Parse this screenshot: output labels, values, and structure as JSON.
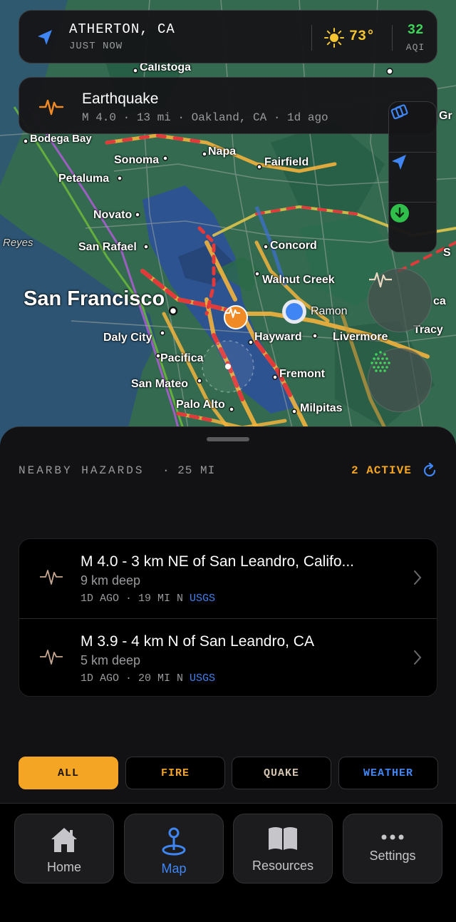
{
  "map": {
    "cities": [
      {
        "name": "Calistoga",
        "cls": ""
      },
      {
        "name": "Bodega Bay",
        "cls": ""
      },
      {
        "name": "Sonoma",
        "cls": ""
      },
      {
        "name": "Napa",
        "cls": ""
      },
      {
        "name": "Fairfield",
        "cls": ""
      },
      {
        "name": "Petaluma",
        "cls": ""
      },
      {
        "name": "Novato",
        "cls": ""
      },
      {
        "name": "Reyes",
        "cls": "italic"
      },
      {
        "name": "San Rafael",
        "cls": ""
      },
      {
        "name": "Concord",
        "cls": ""
      },
      {
        "name": "Walnut Creek",
        "cls": ""
      },
      {
        "name": "San Francisco",
        "cls": "big"
      },
      {
        "name": "Ramon",
        "cls": ""
      },
      {
        "name": "Daly City",
        "cls": ""
      },
      {
        "name": "Hayward",
        "cls": ""
      },
      {
        "name": "Livermore",
        "cls": ""
      },
      {
        "name": "Pacifica",
        "cls": ""
      },
      {
        "name": "Fremont",
        "cls": ""
      },
      {
        "name": "San Mateo",
        "cls": ""
      },
      {
        "name": "Palo Alto",
        "cls": ""
      },
      {
        "name": "Milpitas",
        "cls": ""
      },
      {
        "name": "Tracy",
        "cls": ""
      },
      {
        "name": "Gr",
        "cls": ""
      },
      {
        "name": "ca",
        "cls": ""
      },
      {
        "name": "S",
        "cls": ""
      }
    ]
  },
  "location_bar": {
    "place": "ATHERTON, CA",
    "updated": "JUST NOW",
    "temperature": "73°",
    "aqi_value": "32",
    "aqi_label": "AQI"
  },
  "alert_banner": {
    "title": "Earthquake",
    "subtitle": "M 4.0 · 13 mi · Oakland, CA · 1d ago"
  },
  "sheet": {
    "title": "NEARBY HAZARDS",
    "distance": "· 25 MI",
    "active": "2 ACTIVE",
    "hazards": [
      {
        "title": "M 4.0 - 3 km NE of San Leandro, Califo...",
        "depth": "9 km deep",
        "meta": "1D AGO · 19 MI N",
        "source": "USGS"
      },
      {
        "title": "M 3.9 - 4 km N of San Leandro, CA",
        "depth": "5 km deep",
        "meta": "1D AGO · 20 MI N",
        "source": "USGS"
      }
    ],
    "filters": [
      {
        "label": "ALL",
        "color": "#1a1300"
      },
      {
        "label": "FIRE",
        "color": "#f5a524"
      },
      {
        "label": "QUAKE",
        "color": "#d3c4b0"
      },
      {
        "label": "WEATHER",
        "color": "#3f86f4"
      }
    ]
  },
  "tabs": [
    {
      "label": "Home"
    },
    {
      "label": "Map"
    },
    {
      "label": "Resources"
    },
    {
      "label": "Settings"
    }
  ],
  "colors": {
    "accent_orange": "#f5a524",
    "accent_blue": "#3f86f4",
    "aqi_green": "#3fd45a"
  }
}
